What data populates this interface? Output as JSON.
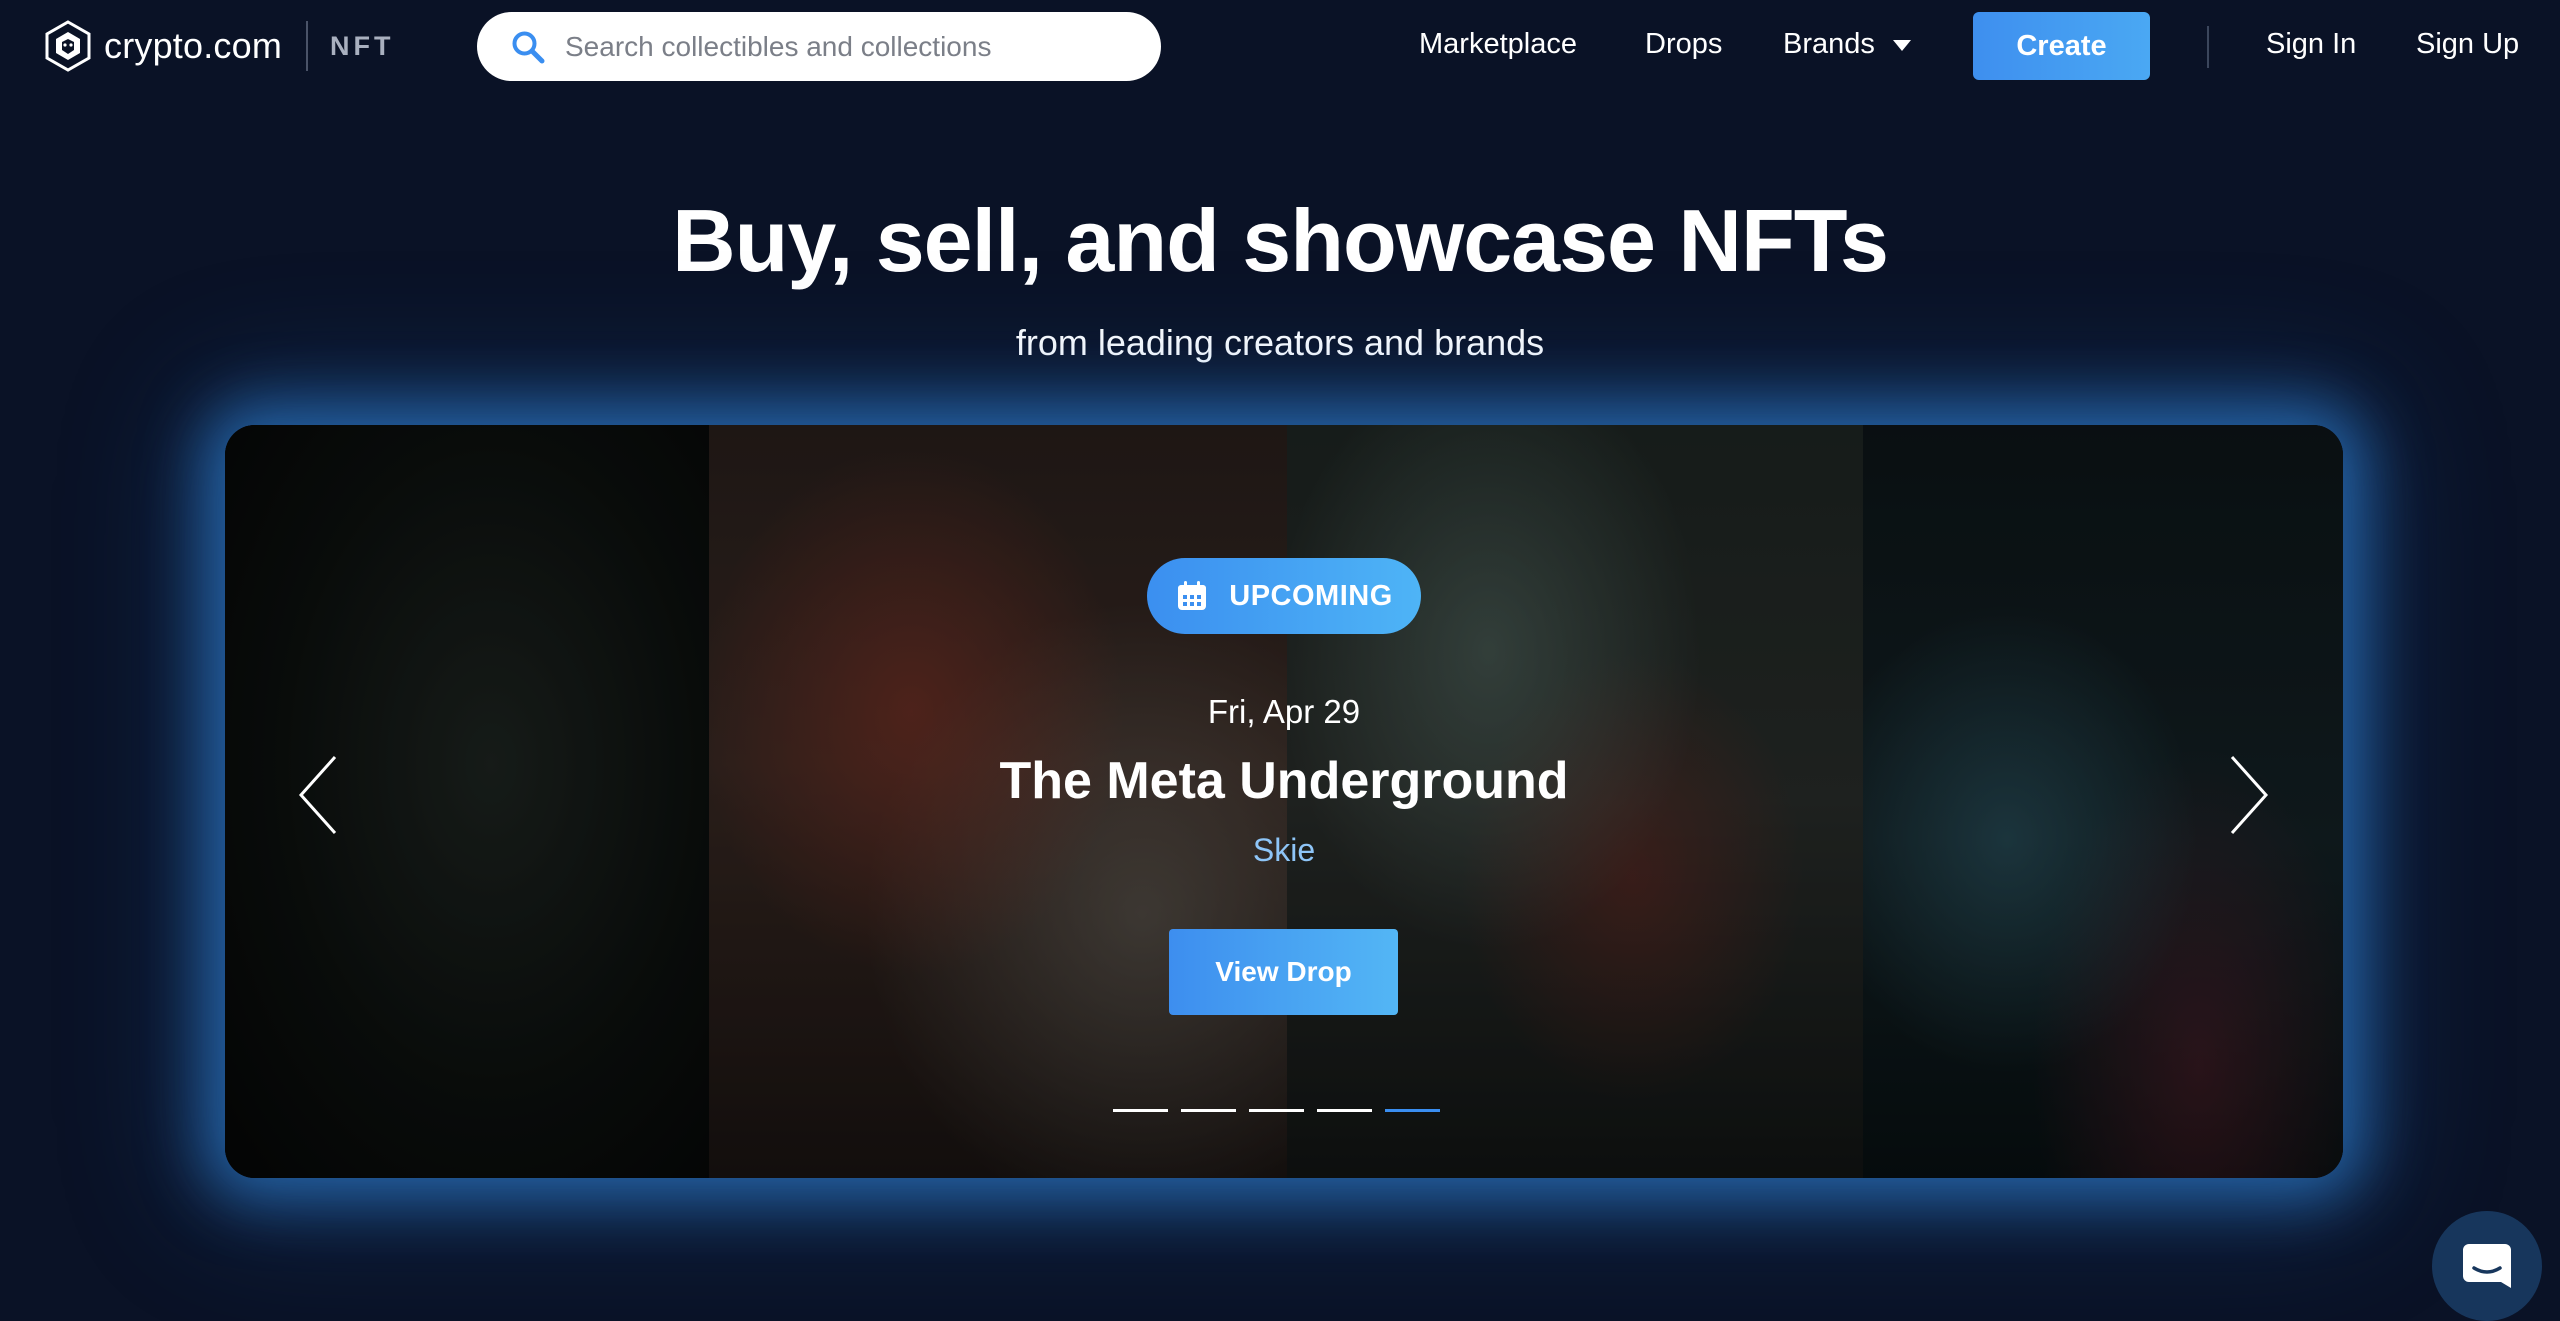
{
  "header": {
    "logo_text": "crypto.com",
    "logo_suffix": "NFT",
    "search": {
      "placeholder": "Search collectibles and collections",
      "value": ""
    },
    "nav": {
      "marketplace": "Marketplace",
      "drops": "Drops",
      "brands": "Brands",
      "create": "Create",
      "sign_in": "Sign In",
      "sign_up": "Sign Up"
    }
  },
  "hero": {
    "title": "Buy, sell, and showcase NFTs",
    "subtitle": "from leading creators and brands"
  },
  "carousel": {
    "badge": "UPCOMING",
    "date": "Fri, Apr 29",
    "title": "The Meta Underground",
    "creator": "Skie",
    "cta": "View Drop",
    "slide_count": 5,
    "active_slide": 5
  },
  "icons": {
    "logo": "crypto-lion-icon",
    "search": "search-icon",
    "badge": "calendar-icon",
    "prev": "chevron-left-icon",
    "next": "chevron-right-icon",
    "chat": "chat-icon"
  },
  "colors": {
    "background": "#0a1226",
    "accent": "#3b8ff0",
    "creator": "#8ec5f7",
    "glow": "#3494f0"
  }
}
